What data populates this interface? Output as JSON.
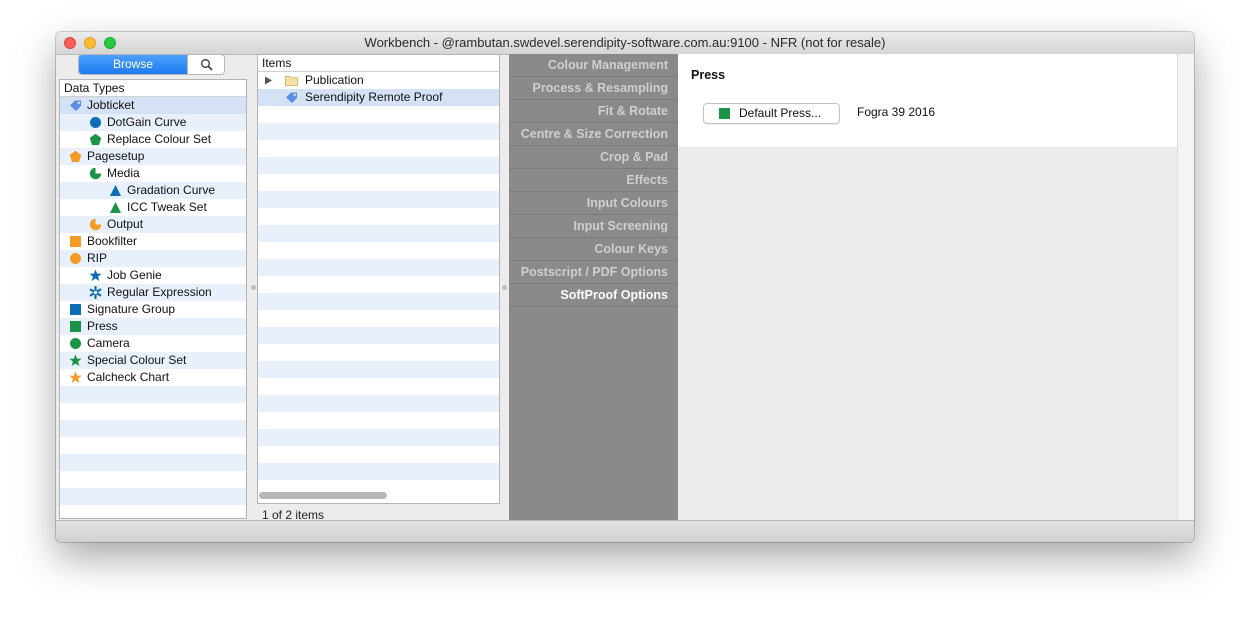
{
  "window": {
    "title": "Workbench - @rambutan.swdevel.serendipity-software.com.au:9100 - NFR (not for resale)"
  },
  "toolbar": {
    "browse_label": "Browse",
    "search_icon": "magnifier-icon"
  },
  "data_types": {
    "header": "Data Types",
    "items": [
      {
        "label": "Jobticket",
        "icon": "tag",
        "color": "#5b8ee6",
        "indent": 0,
        "selected": true
      },
      {
        "label": "DotGain Curve",
        "icon": "circle",
        "color": "#0a6db5",
        "indent": 1
      },
      {
        "label": "Replace Colour Set",
        "icon": "pentagon",
        "color": "#1a9447",
        "indent": 1
      },
      {
        "label": "Pagesetup",
        "icon": "pentagon",
        "color": "#f39a27",
        "indent": 0
      },
      {
        "label": "Media",
        "icon": "crescent",
        "color": "#1a9447",
        "indent": 1
      },
      {
        "label": "Gradation Curve",
        "icon": "triangle",
        "color": "#0a6db5",
        "indent": 2
      },
      {
        "label": "ICC Tweak Set",
        "icon": "triangle",
        "color": "#1a9447",
        "indent": 2
      },
      {
        "label": "Output",
        "icon": "crescent",
        "color": "#f39a27",
        "indent": 1
      },
      {
        "label": "Bookfilter",
        "icon": "square",
        "color": "#f39a27",
        "indent": 0
      },
      {
        "label": "RIP",
        "icon": "circle",
        "color": "#f39a27",
        "indent": 0
      },
      {
        "label": "Job Genie",
        "icon": "star",
        "color": "#0a6db5",
        "indent": 1
      },
      {
        "label": "Regular Expression",
        "icon": "asterisk",
        "color": "#0a6db5",
        "indent": 1
      },
      {
        "label": "Signature Group",
        "icon": "square",
        "color": "#0a6db5",
        "indent": 0
      },
      {
        "label": "Press",
        "icon": "square",
        "color": "#1a9447",
        "indent": 0
      },
      {
        "label": "Camera",
        "icon": "circle",
        "color": "#1a9447",
        "indent": 0
      },
      {
        "label": "Special Colour Set",
        "icon": "star",
        "color": "#1a9447",
        "indent": 0
      },
      {
        "label": "Calcheck Chart",
        "icon": "star",
        "color": "#f39a27",
        "indent": 0
      }
    ]
  },
  "items_panel": {
    "header": "Items",
    "rows": [
      {
        "label": "Publication",
        "icon": "folder",
        "expandable": true,
        "selected": false
      },
      {
        "label": "Serendipity Remote Proof",
        "icon": "tag",
        "selected": true
      }
    ],
    "status": "1 of 2 items"
  },
  "tabs": [
    {
      "label": "Colour Management",
      "active": false
    },
    {
      "label": "Process & Resampling",
      "active": false
    },
    {
      "label": "Fit & Rotate",
      "active": false
    },
    {
      "label": "Centre & Size Correction",
      "active": false
    },
    {
      "label": "Crop & Pad",
      "active": false
    },
    {
      "label": "Effects",
      "active": false
    },
    {
      "label": "Input Colours",
      "active": false
    },
    {
      "label": "Input Screening",
      "active": false
    },
    {
      "label": "Colour Keys",
      "active": false
    },
    {
      "label": "Postscript / PDF Options",
      "active": false
    },
    {
      "label": "SoftProof Options",
      "active": true
    }
  ],
  "press_section": {
    "title": "Press",
    "button_label": "Default Press...",
    "swatch_color": "#1a9447",
    "value": "Fogra 39 2016"
  }
}
